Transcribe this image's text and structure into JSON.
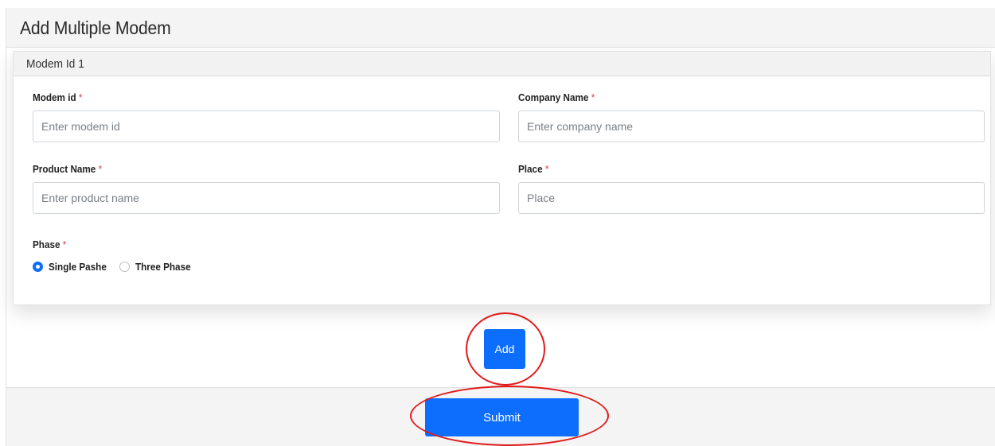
{
  "page": {
    "title": "Add Multiple Modem"
  },
  "card": {
    "header": "Modem Id 1"
  },
  "fields": {
    "modem_id": {
      "label": "Modem id",
      "required_mark": "*",
      "placeholder": "Enter modem id"
    },
    "company_name": {
      "label": "Company Name",
      "required_mark": "*",
      "placeholder": "Enter company name"
    },
    "product_name": {
      "label": "Product Name",
      "required_mark": "*",
      "placeholder": "Enter product name"
    },
    "place": {
      "label": "Place",
      "required_mark": "*",
      "placeholder": "Place"
    },
    "phase": {
      "label": "Phase",
      "required_mark": "*",
      "options": [
        {
          "label": "Single Pashe",
          "checked": true
        },
        {
          "label": "Three Phase",
          "checked": false
        }
      ]
    }
  },
  "buttons": {
    "add": "Add",
    "submit": "Submit"
  },
  "colors": {
    "primary": "#0d6efd",
    "required": "#dc3545",
    "annotation": "#e11a1a"
  }
}
